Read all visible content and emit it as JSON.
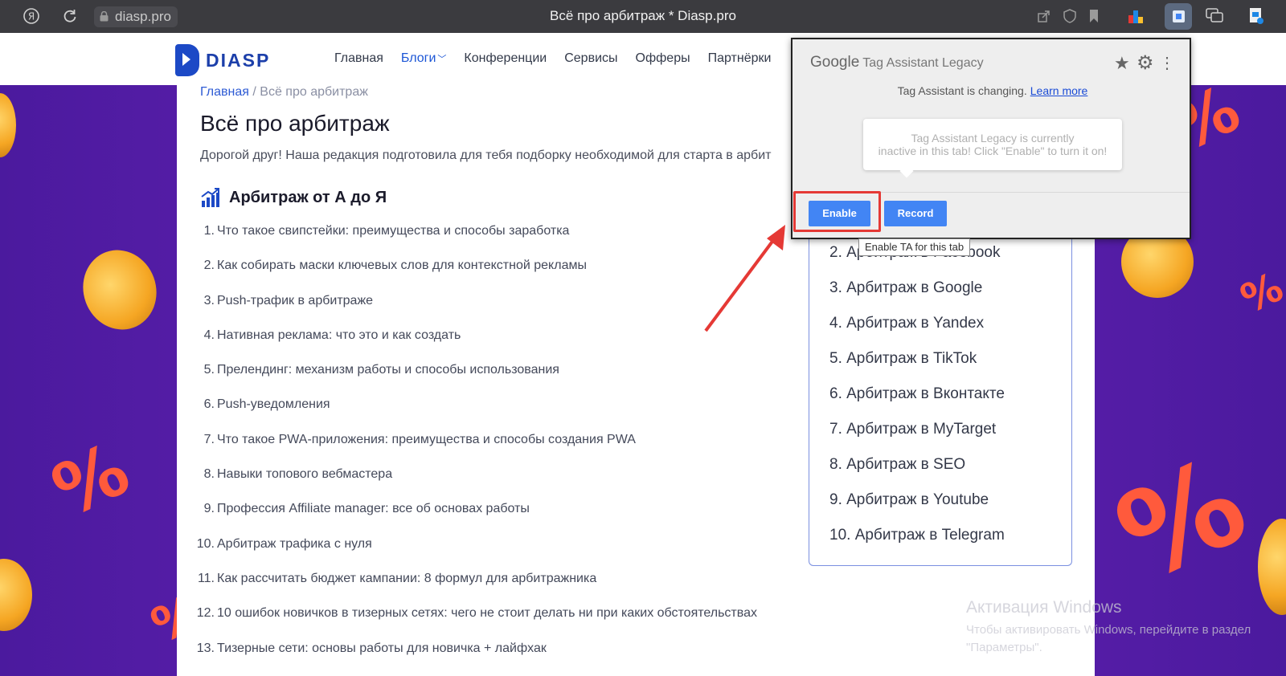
{
  "browser": {
    "url": "diasp.pro",
    "window_title": "Всё про арбитраж * Diasp.pro"
  },
  "site": {
    "logo_text": "DIASP",
    "nav": [
      {
        "label": "Главная"
      },
      {
        "label": "Блоги"
      },
      {
        "label": "Конференции"
      },
      {
        "label": "Сервисы"
      },
      {
        "label": "Офферы"
      },
      {
        "label": "Партнёрки"
      }
    ]
  },
  "page": {
    "breadcrumb_home": "Главная",
    "breadcrumb_sep": "/",
    "breadcrumb_current": "Всё про арбитраж",
    "title": "Всё про арбитраж",
    "intro": "Дорогой друг! Наша редакция подготовила для тебя подборку необходимой для старта в арбит",
    "section_title": "Арбитраж от А до Я",
    "articles": [
      {
        "num": "1.",
        "text": "Что такое свипстейки: преимущества и способы заработка"
      },
      {
        "num": "2.",
        "text": "Как собирать маски ключевых слов для контекстной рекламы"
      },
      {
        "num": "3.",
        "text": "Push-трафик в арбитраже"
      },
      {
        "num": "4.",
        "text": "Нативная реклама: что это и как создать"
      },
      {
        "num": "5.",
        "text": "Прелендинг: механизм работы и способы использования"
      },
      {
        "num": "6.",
        "text": "Push-уведомления"
      },
      {
        "num": "7.",
        "text": "Что такое PWA-приложения: преимущества и способы создания PWA"
      },
      {
        "num": "8.",
        "text": "Навыки топового вебмастера"
      },
      {
        "num": "9.",
        "text": "Профессия Affiliate manager: все об основах работы"
      },
      {
        "num": "10.",
        "text": "Арбитраж трафика с нуля"
      },
      {
        "num": "11.",
        "text": "Как рассчитать бюджет кампании: 8 формул для арбитражника"
      },
      {
        "num": "12.",
        "text": "10 ошибок новичков в тизерных сетях: чего не стоит делать ни при каких обстоятельствах"
      },
      {
        "num": "13.",
        "text": "Тизерные сети: основы работы для новичка + лайфхак"
      }
    ],
    "sidebar": [
      {
        "label": "2. Арбитраж в Facebook"
      },
      {
        "label": "3. Арбитраж в Google"
      },
      {
        "label": "4. Арбитраж в Yandex"
      },
      {
        "label": "5. Арбитраж в TikTok"
      },
      {
        "label": "6. Арбитраж в Вконтакте"
      },
      {
        "label": "7. Арбитраж в MyTarget"
      },
      {
        "label": "8. Арбитраж в SEO"
      },
      {
        "label": "9. Арбитраж в Youtube"
      },
      {
        "label": "10. Арбитраж в Telegram"
      }
    ]
  },
  "tag_assistant": {
    "brand": "Google",
    "name": "Tag Assistant Legacy",
    "changing_text": "Tag Assistant is changing.",
    "learn_more": "Learn more",
    "bubble_line1": "Tag Assistant Legacy is currently",
    "bubble_line2": "inactive in this tab! Click \"Enable\" to turn it on!",
    "enable_label": "Enable",
    "record_label": "Record",
    "tooltip": "Enable TA for this tab"
  },
  "windows_watermark": {
    "title": "Активация Windows",
    "line1": "Чтобы активировать Windows, перейдите в раздел",
    "line2": "\"Параметры\"."
  },
  "colors": {
    "accent": "#4285f4",
    "annotation": "#e53935",
    "brand": "#1c49c6"
  }
}
